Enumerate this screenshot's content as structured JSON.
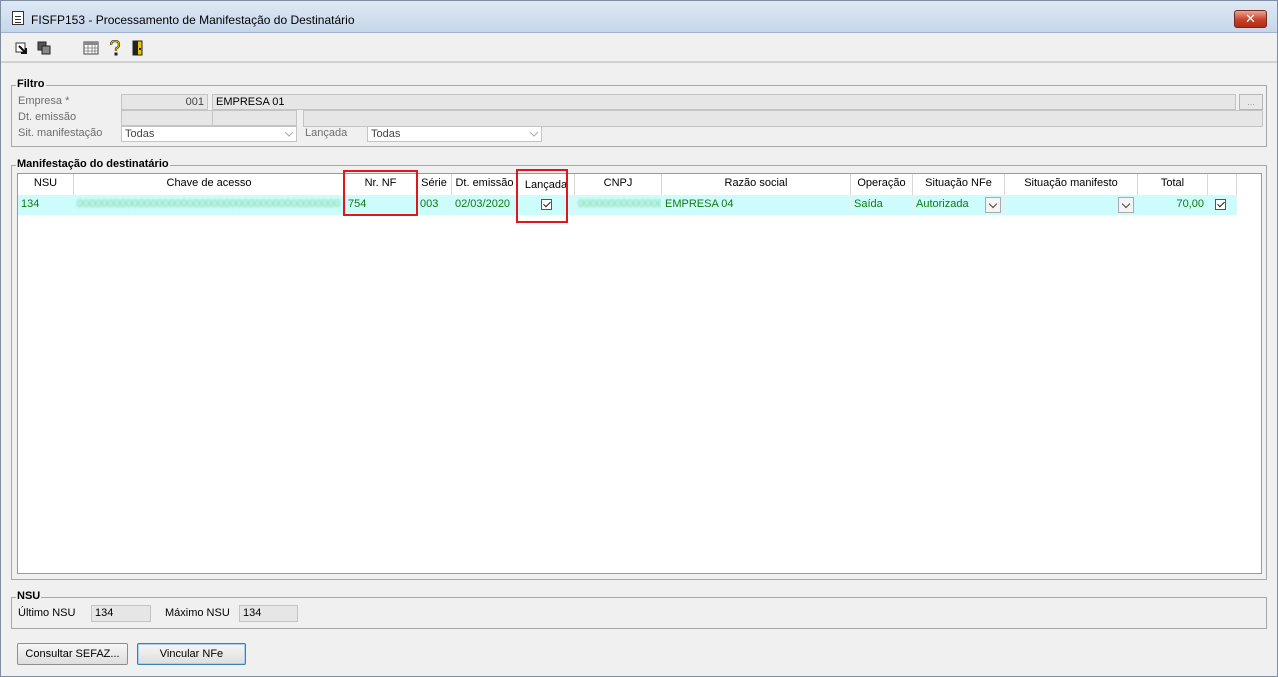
{
  "window": {
    "title": "FISFP153 - Processamento de Manifestação do Destinatário",
    "close_label": "✕"
  },
  "toolbar": {
    "icons": [
      "export-icon",
      "copy-icon",
      "calendar-grid-icon",
      "help-icon",
      "exit-door-icon"
    ]
  },
  "filtro": {
    "label": "Filtro",
    "empresa_label": "Empresa *",
    "empresa_code": "001",
    "empresa_name": "EMPRESA 01",
    "lookup_label": "...",
    "dt_emissao_label": "Dt. emissão",
    "dt_emissao_from": "",
    "dt_emissao_to": "",
    "sit_manifestacao_label": "Sit. manifestação",
    "sit_manifestacao_value": "Todas",
    "lancada_label": "Lançada",
    "lancada_value": "Todas"
  },
  "grid": {
    "label": "Manifestação do destinatário",
    "columns": [
      "NSU",
      "Chave de acesso",
      "Nr. NF",
      "Série",
      "Dt. emissão",
      "Lançada",
      "CNPJ",
      "Razão social",
      "Operação",
      "Situação NFe",
      "Situação manifesto",
      "Total"
    ],
    "rows": [
      {
        "nsu": "134",
        "chave": "0000000000000000000000000000000000000000000",
        "nr_nf": "754",
        "serie": "003",
        "dt_emissao": "02/03/2020",
        "lancada": true,
        "cnpj": "00000000000000",
        "razao_social": "EMPRESA 04",
        "operacao": "Saída",
        "situacao_nfe": "Autorizada",
        "situacao_manifesto": "",
        "total": "70,00",
        "selected": true
      }
    ]
  },
  "nsu": {
    "label": "NSU",
    "ultimo_label": "Último NSU",
    "ultimo_value": "134",
    "maximo_label": "Máximo NSU",
    "maximo_value": "134"
  },
  "buttons": {
    "consultar": "Consultar SEFAZ...",
    "vincular": "Vincular NFe"
  },
  "colors": {
    "row_highlight": "#cdfcfc",
    "row_text": "#107a10",
    "annotation_red": "#e0161a"
  }
}
